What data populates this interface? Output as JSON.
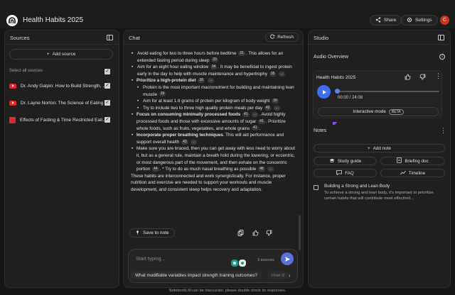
{
  "app": {
    "title": "Health Habits 2025",
    "avatar_initial": "C"
  },
  "topbar": {
    "share_label": "Share",
    "settings_label": "Settings"
  },
  "sources": {
    "title": "Sources",
    "add_label": "Add source",
    "select_all_label": "Select all sources",
    "items": [
      {
        "label": "Dr. Andy Galpin: How to Build Strength, ...",
        "type": "youtube"
      },
      {
        "label": "Dr. Layne Norton: The Science of Eating ...",
        "type": "youtube"
      },
      {
        "label": "Effects of Fasting & Time Restricted Eati...",
        "type": "pdf"
      }
    ]
  },
  "chat": {
    "title": "Chat",
    "refresh_label": "Refresh",
    "body": {
      "p1": "Avoid eating for two to three hours before bedtime",
      "c1": "31",
      "p1b": ". This allows for an extended fasting period during sleep",
      "c2": "33",
      "p2": "Aim for an eight hour eating window",
      "c3": "34",
      "p2b": ". It may be beneficial to ingest protein early in the day to help with muscle maintenance and hypertrophy",
      "c4": "35",
      "dots": "...",
      "h2": "Prioritize a high-protein diet",
      "c5": "38",
      "p3": "Protein is the most important macronutrient for building and maintaining lean muscle",
      "c6": "39",
      "p4": "Aim for at least 1.6 grams of protein per kilogram of body weight",
      "c7": "39",
      "p5": "Try to include two to three high quality protein meals per day",
      "c8": "40",
      "h3": "Focus on consuming minimally processed foods",
      "c9": "41",
      "p6": ". Avoid highly processed foods and those with excessive amounts of sugar",
      "c10": "41",
      "p6b": ". Prioritize whole foods, such as fruits, vegetables, and whole grains",
      "c11": "41",
      "p6c": ".",
      "h4": "Incorporate proper breathing techniques",
      "p7": ". This will aid performance and support overall health",
      "c12": "43",
      "p8": "Make sure you are braced, then you can get away with less need to worry about it, but as a general rule, maintain a breath hold during the lowering, or eccentric, or most dangerous part of the movement, and then exhale on the concentric portion",
      "c13": "44",
      "p8b": ". * Try to do as much nasal breathing as possible",
      "c14": "48",
      "p9": "These habits are interconnected and work synergistically. For instance, proper nutrition and exercise are needed to support your workouts and muscle development, and consistent sleep helps recovery and adaptation."
    },
    "save_note_label": "Save to note",
    "input_placeholder": "Start typing...",
    "source_count": "3 sources",
    "suggestions": [
      "What modifiable variables impact strength training outcomes?",
      "How d"
    ]
  },
  "studio": {
    "title": "Studio",
    "audio_overview_label": "Audio Overview",
    "audio": {
      "title": "Health Habits 2025",
      "time": "00:00 / 24:08",
      "progress": 0
    },
    "interactive_label": "Interactive mode",
    "beta_label": "BETA",
    "notes_label": "Notes",
    "add_note_label": "Add note",
    "buttons": [
      "Study guide",
      "Briefing doc",
      "FAQ",
      "Timeline"
    ],
    "note": {
      "title": "Building a Strong and Lean Body",
      "text": "To achieve a strong and lean body, it's important to prioritize certain habits that will contribute most effectivel..."
    }
  },
  "footer": {
    "text": "NotebookLM can be inaccurate; please double check its responses."
  },
  "colors": {
    "accent": "#3c6ff0",
    "send": "#5b6fd6",
    "youtube": "#e1262c",
    "avatar": "#c5341e"
  }
}
